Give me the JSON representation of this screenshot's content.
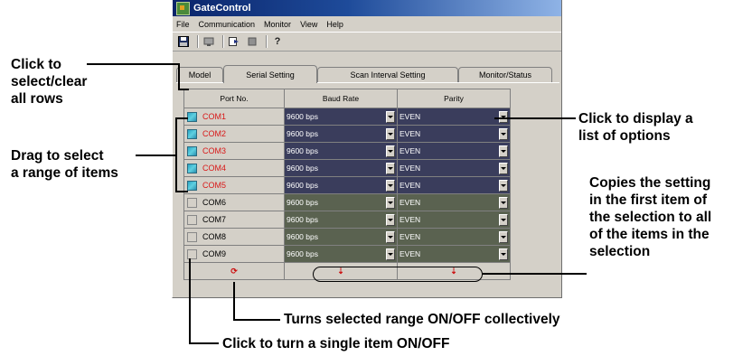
{
  "window": {
    "title": "GateControl",
    "menu": [
      "File",
      "Communication",
      "Monitor",
      "View",
      "Help"
    ],
    "toolbar_icons": [
      "save-icon",
      "port-icon",
      "start-icon",
      "stop-icon",
      "help-icon"
    ]
  },
  "tabs": [
    {
      "label": "Model",
      "active": false
    },
    {
      "label": "Serial Setting",
      "active": true
    },
    {
      "label": "Scan Interval Setting",
      "active": false
    },
    {
      "label": "Monitor/Status",
      "active": false
    }
  ],
  "grid": {
    "headers": [
      "Port No.",
      "Baud Rate",
      "Parity"
    ],
    "rows": [
      {
        "port": "COM1",
        "checked": true,
        "baud": "9600 bps",
        "parity": "EVEN",
        "selected": true
      },
      {
        "port": "COM2",
        "checked": true,
        "baud": "9600 bps",
        "parity": "EVEN",
        "selected": true
      },
      {
        "port": "COM3",
        "checked": true,
        "baud": "9600 bps",
        "parity": "EVEN",
        "selected": true
      },
      {
        "port": "COM4",
        "checked": true,
        "baud": "9600 bps",
        "parity": "EVEN",
        "selected": true
      },
      {
        "port": "COM5",
        "checked": true,
        "baud": "9600 bps",
        "parity": "EVEN",
        "selected": true
      },
      {
        "port": "COM6",
        "checked": false,
        "baud": "9600 bps",
        "parity": "EVEN",
        "selected": false
      },
      {
        "port": "COM7",
        "checked": false,
        "baud": "9600 bps",
        "parity": "EVEN",
        "selected": false
      },
      {
        "port": "COM8",
        "checked": false,
        "baud": "9600 bps",
        "parity": "EVEN",
        "selected": false
      },
      {
        "port": "COM9",
        "checked": false,
        "baud": "9600 bps",
        "parity": "EVEN",
        "selected": false
      }
    ]
  },
  "annotations": {
    "select_clear": [
      "Click to",
      "select/clear",
      "all rows"
    ],
    "drag_select": [
      "Drag to select",
      "a range of items"
    ],
    "display_options": [
      "Click to display a",
      "list of options"
    ],
    "copies_setting": [
      "Copies the setting",
      "in the first item of",
      "the selection to all",
      "of the items in the",
      "selection"
    ],
    "turns_range": "Turns selected range ON/OFF collectively",
    "single_item": "Click to turn a single item ON/OFF"
  },
  "colors": {
    "selected_cell": "#3a3d5c",
    "unselected_cell": "#5a6250",
    "selected_port_text": "#d81818",
    "title_bar": "#0a246a"
  }
}
